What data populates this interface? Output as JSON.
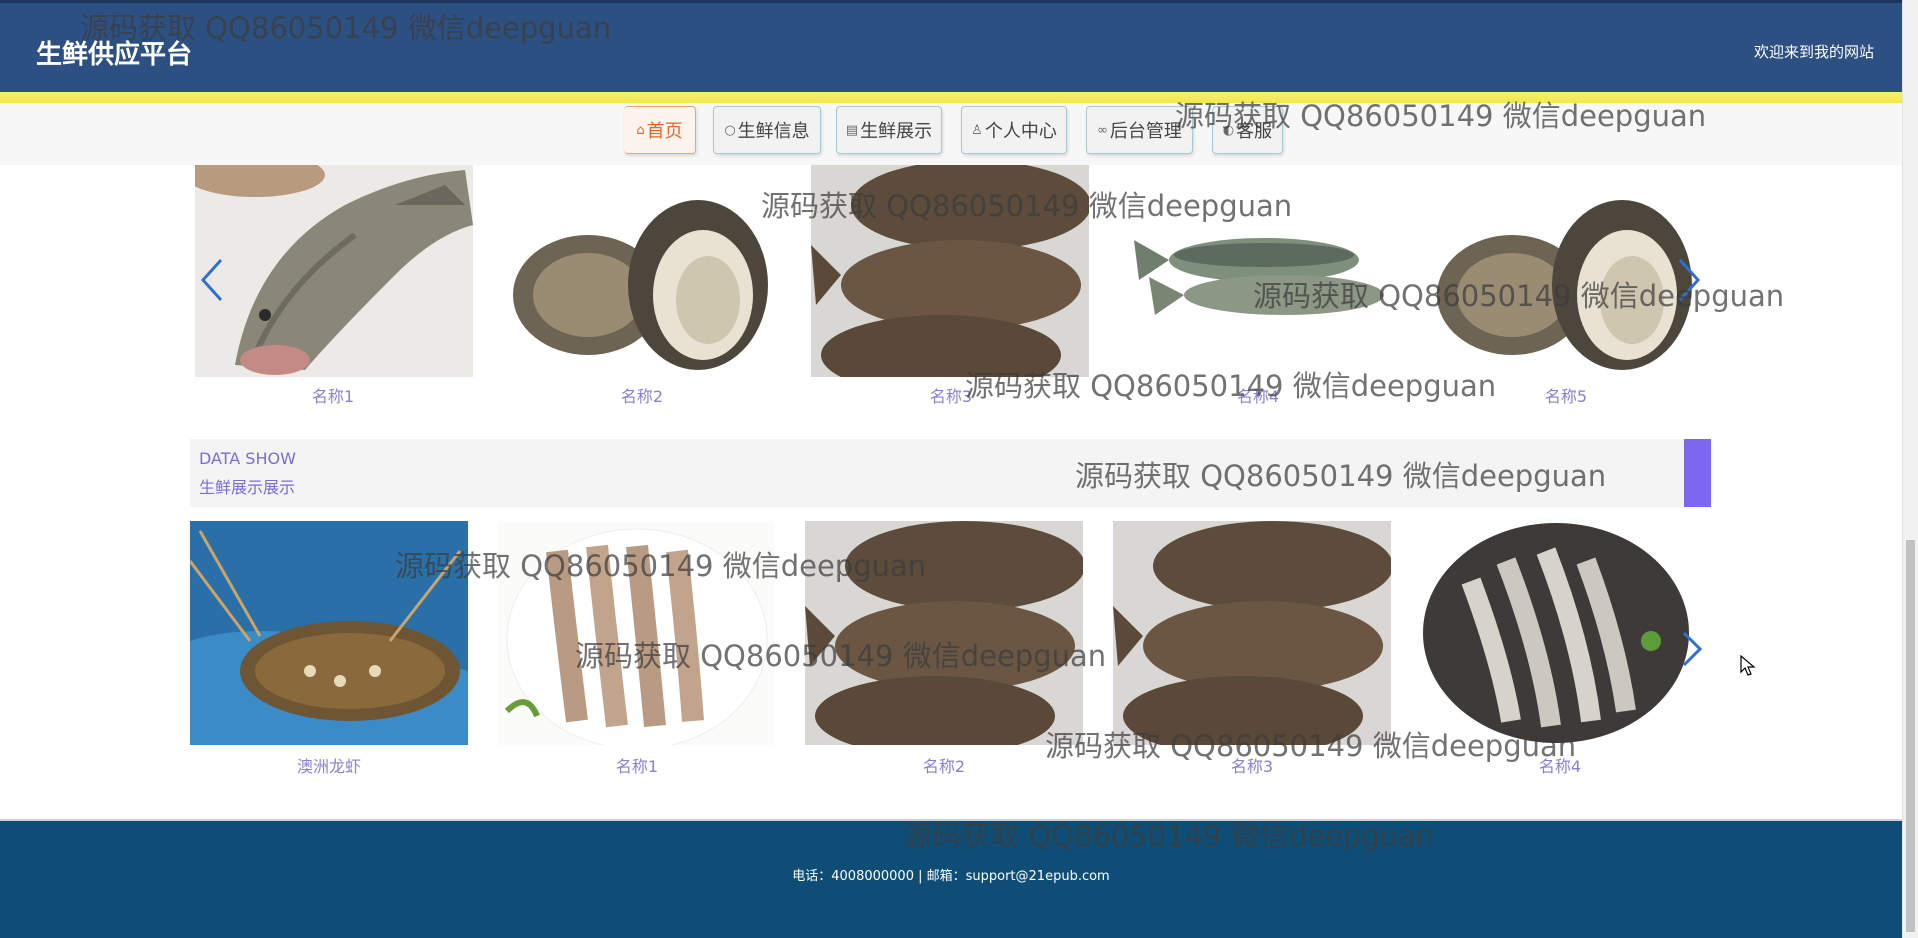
{
  "header": {
    "site_title": "生鲜供应平台",
    "welcome": "欢迎来到我的网站"
  },
  "nav": {
    "items": [
      {
        "label": "首页",
        "icon": "home-icon"
      },
      {
        "label": "生鲜信息",
        "icon": "circle-icon"
      },
      {
        "label": "生鲜展示",
        "icon": "document-icon"
      },
      {
        "label": "个人中心",
        "icon": "user-icon"
      },
      {
        "label": "后台管理",
        "icon": "link-icon"
      },
      {
        "label": "客服",
        "icon": "chat-icon"
      }
    ]
  },
  "top_carousel": {
    "items": [
      {
        "caption": "名称1",
        "image": "grouper-fish"
      },
      {
        "caption": "名称2",
        "image": "oyster"
      },
      {
        "caption": "名称3",
        "image": "flounder"
      },
      {
        "caption": "名称4",
        "image": "carp-fish"
      },
      {
        "caption": "名称5",
        "image": "oyster"
      }
    ]
  },
  "section": {
    "en_title": "DATA SHOW",
    "zh_title": "生鲜展示展示",
    "accent_color": "#7b68ee"
  },
  "bottom_carousel": {
    "items": [
      {
        "caption": "澳洲龙虾",
        "image": "lobster"
      },
      {
        "caption": "名称1",
        "image": "shrimp-plate"
      },
      {
        "caption": "名称2",
        "image": "flounder"
      },
      {
        "caption": "名称3",
        "image": "flounder"
      },
      {
        "caption": "名称4",
        "image": "shrimp-black-plate"
      }
    ]
  },
  "footer": {
    "text": "电话：4008000000 | 邮箱：support@21epub.com"
  },
  "watermark": {
    "text": "源码获取 QQ86050149 微信deepguan"
  },
  "colors": {
    "header_bg": "#2d5083",
    "footer_bg": "#0e4e76",
    "caption": "#8c7fd3",
    "active_nav": "#e06a2d"
  }
}
